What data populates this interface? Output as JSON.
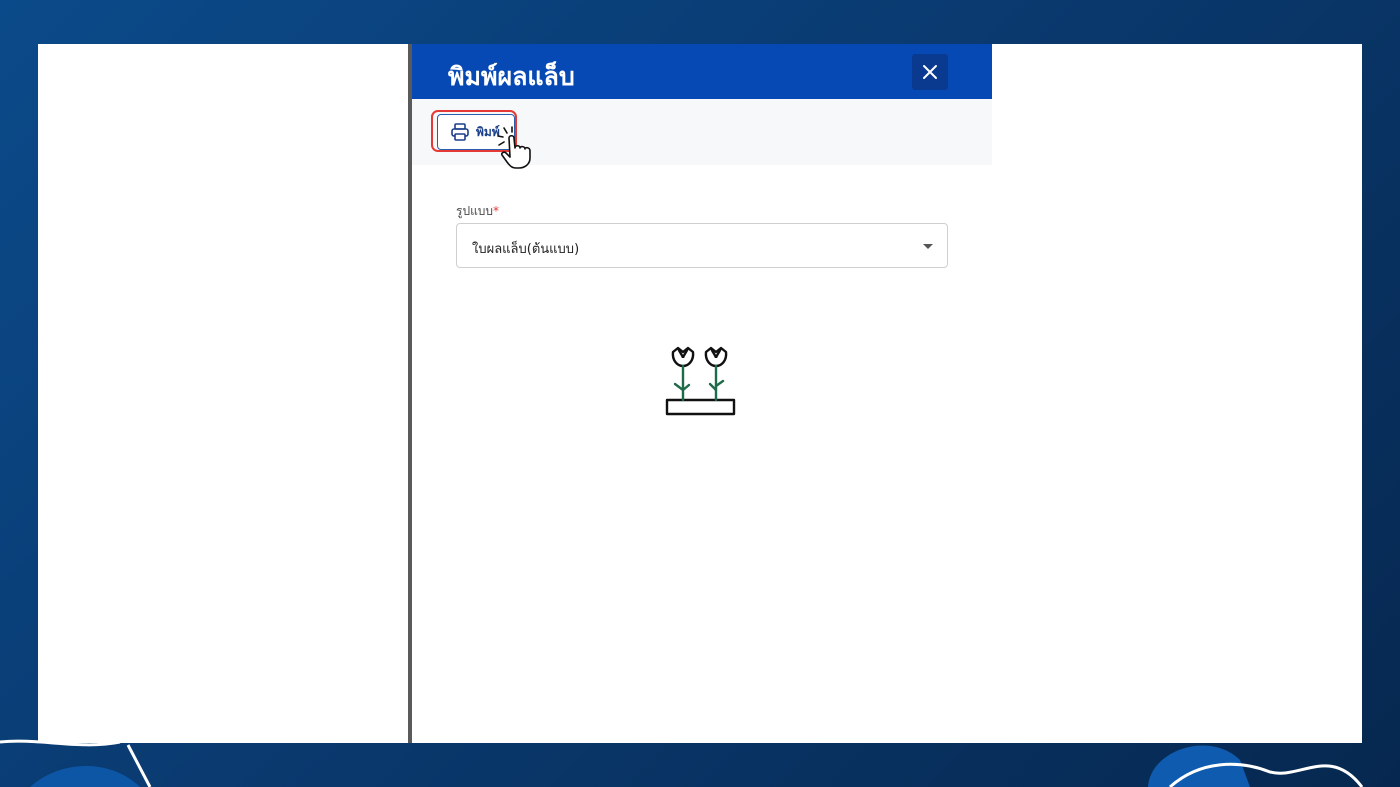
{
  "dialog": {
    "title": "พิมพ์ผลแล็บ",
    "close_icon": "close-icon"
  },
  "toolbar": {
    "print_label": "พิมพ์",
    "print_icon": "printer-icon",
    "highlight_color": "#e53935",
    "pointer_icon": "hand-pointer-icon"
  },
  "form": {
    "format_label": "รูปแบบ",
    "required_mark": "*",
    "format_value": "ใบผลแล็บ(ต้นแบบ)"
  },
  "colors": {
    "header": "#0649b4",
    "background": "#0a3a70",
    "accent_green": "#1e6b4a"
  },
  "illustration": "flowers-in-planter-icon"
}
